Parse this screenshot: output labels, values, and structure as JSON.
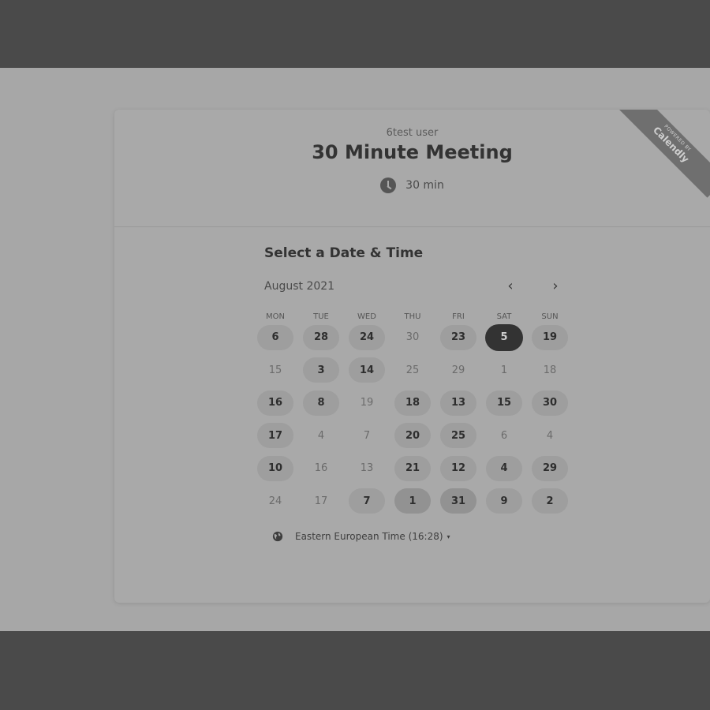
{
  "event": {
    "owner": "6test user",
    "title": "30 Minute Meeting",
    "duration": "30 min"
  },
  "ribbon": {
    "small": "POWERED BY",
    "brand": "Calendly"
  },
  "picker": {
    "section_title": "Select a Date & Time",
    "month": "August 2021",
    "prev_icon": "‹",
    "next_icon": "›",
    "weekdays": [
      "MON",
      "TUE",
      "WED",
      "THU",
      "FRI",
      "SAT",
      "SUN"
    ],
    "weeks": [
      [
        {
          "d": "6",
          "a": true
        },
        {
          "d": "28",
          "a": true
        },
        {
          "d": "24",
          "a": true
        },
        {
          "d": "30",
          "a": false
        },
        {
          "d": "23",
          "a": true
        },
        {
          "d": "5",
          "a": true,
          "selected": true
        },
        {
          "d": "19",
          "a": true
        }
      ],
      [
        {
          "d": "15",
          "a": false
        },
        {
          "d": "3",
          "a": true
        },
        {
          "d": "14",
          "a": true
        },
        {
          "d": "25",
          "a": false
        },
        {
          "d": "29",
          "a": false
        },
        {
          "d": "1",
          "a": false
        },
        {
          "d": "18",
          "a": false
        }
      ],
      [
        {
          "d": "16",
          "a": true
        },
        {
          "d": "8",
          "a": true
        },
        {
          "d": "19",
          "a": false
        },
        {
          "d": "18",
          "a": true
        },
        {
          "d": "13",
          "a": true
        },
        {
          "d": "15",
          "a": true
        },
        {
          "d": "30",
          "a": true
        }
      ],
      [
        {
          "d": "17",
          "a": true
        },
        {
          "d": "4",
          "a": false
        },
        {
          "d": "7",
          "a": false
        },
        {
          "d": "20",
          "a": true
        },
        {
          "d": "25",
          "a": true
        },
        {
          "d": "6",
          "a": false
        },
        {
          "d": "4",
          "a": false
        }
      ],
      [
        {
          "d": "10",
          "a": true
        },
        {
          "d": "16",
          "a": false
        },
        {
          "d": "13",
          "a": false
        },
        {
          "d": "21",
          "a": true
        },
        {
          "d": "12",
          "a": true
        },
        {
          "d": "4",
          "a": true
        },
        {
          "d": "29",
          "a": true
        }
      ],
      [
        {
          "d": "24",
          "a": false
        },
        {
          "d": "17",
          "a": false
        },
        {
          "d": "7",
          "a": true
        },
        {
          "d": "1",
          "a": true,
          "highlight": true
        },
        {
          "d": "31",
          "a": true,
          "highlight": true
        },
        {
          "d": "9",
          "a": true
        },
        {
          "d": "2",
          "a": true
        }
      ]
    ],
    "timezone": "Eastern European Time (16:28)",
    "timezone_caret": "▾"
  },
  "icons": {
    "clock": "clock-icon",
    "globe": "globe-icon",
    "prev": "chevron-left-icon",
    "next": "chevron-right-icon"
  }
}
